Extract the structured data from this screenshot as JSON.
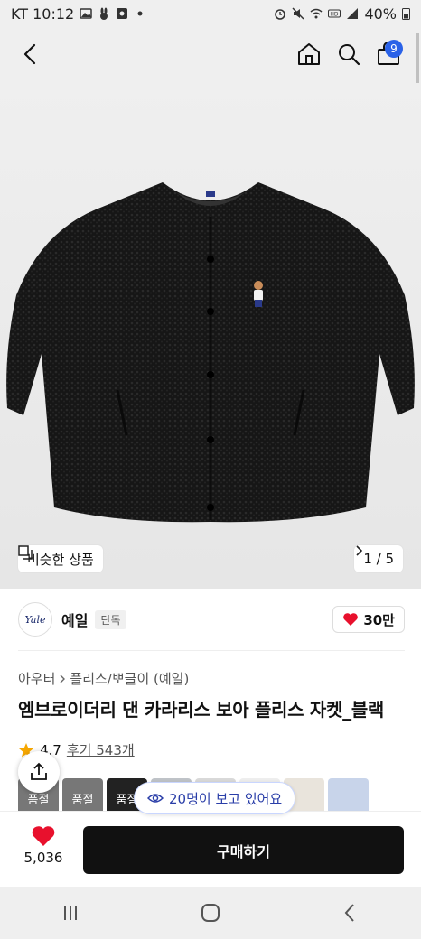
{
  "status_bar": {
    "carrier_time": "KT 10:12",
    "battery": "40%",
    "icons": [
      "gallery-icon",
      "rabbit-icon",
      "app-icon",
      "dot-icon",
      "alarm-icon",
      "mute-icon",
      "wifi-icon",
      "hd-icon",
      "signal-icon",
      "battery-icon"
    ]
  },
  "header": {
    "cart_count": "9",
    "icons": [
      "back-icon",
      "home-icon",
      "search-icon",
      "cart-icon"
    ]
  },
  "gallery": {
    "similar_label": "비슷한 상품",
    "page_indicator": "1 / 5"
  },
  "brand": {
    "logo_text": "Yale",
    "name": "예일",
    "tag": "단독",
    "likes": "30만"
  },
  "breadcrumb": {
    "level1": "아우터",
    "level2": "플리스/뽀글이 (예일)"
  },
  "product": {
    "title": "엠브로이더리 댄 카라리스 보아 플리스 자켓_블랙",
    "rating": "4.7",
    "reviews": "후기 543개"
  },
  "thumbnails": [
    {
      "label": "품절"
    },
    {
      "label": "품절"
    },
    {
      "label": "품절"
    }
  ],
  "viewers": "20명이 보고 있어요",
  "purchase": {
    "wish_count": "5,036",
    "buy_label": "구매하기"
  },
  "colors": {
    "accent": "#2a62e8",
    "heart": "#e8112d",
    "buy_button": "#111111"
  }
}
